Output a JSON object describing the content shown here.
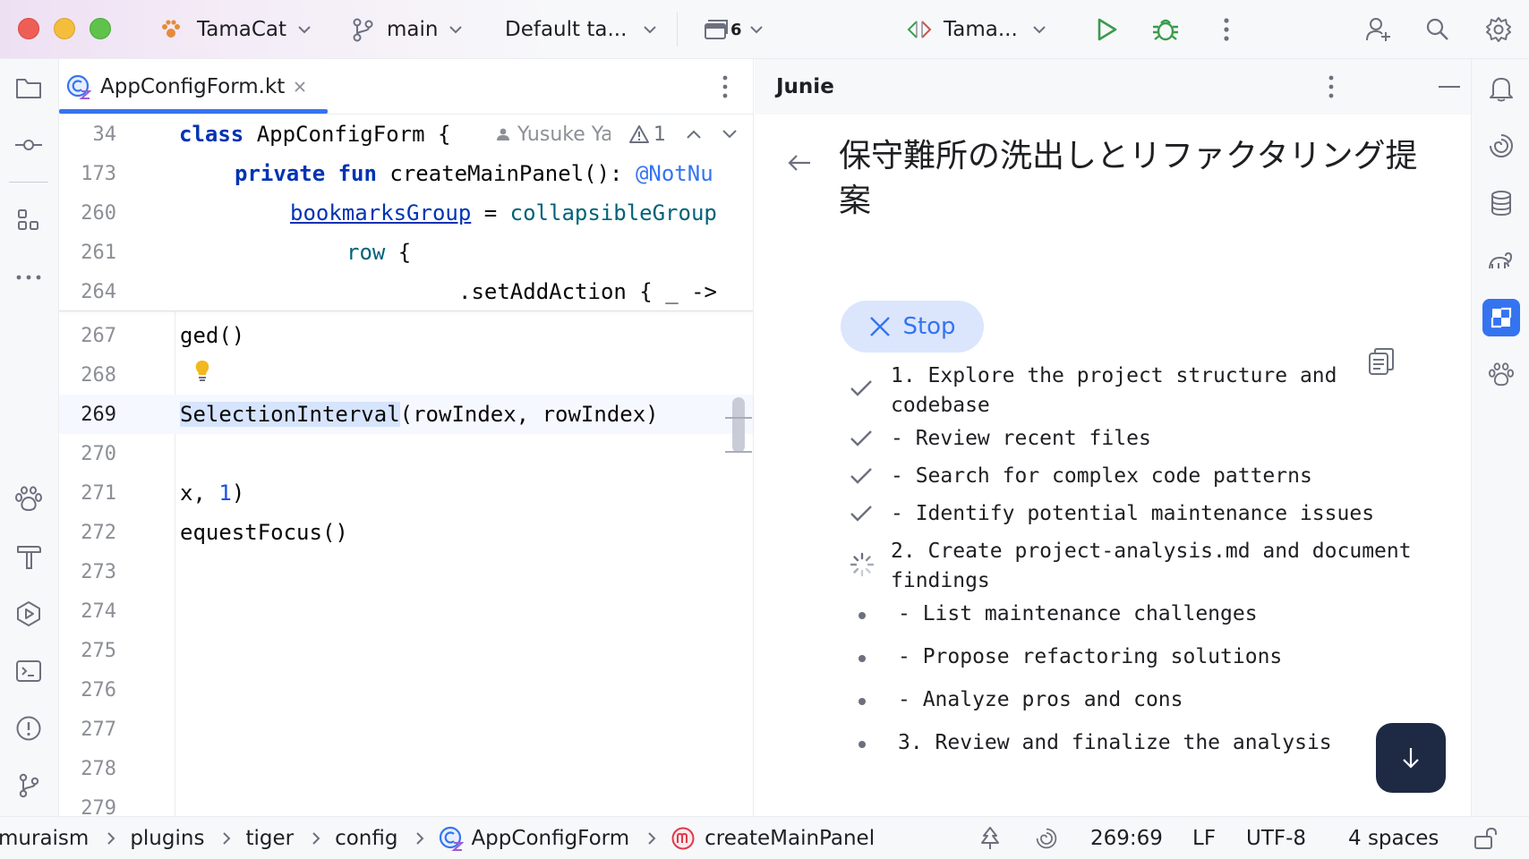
{
  "titlebar": {
    "project_name": "TamaCat",
    "branch_name": "main",
    "task_name": "Default ta...",
    "changes_count": "6",
    "run_config": "Tama...",
    "icons": [
      "project-icon",
      "branch-icon",
      "changes-icon",
      "run-config-icon",
      "run-icon",
      "debug-icon",
      "more-icon",
      "add-user-icon",
      "search-icon",
      "settings-icon"
    ]
  },
  "editor": {
    "tab_label": "AppConfigForm.kt",
    "inline_author": "Yusuke Ya",
    "warning_count": "1",
    "sticky_lines": [
      {
        "num": "34",
        "code": "class AppConfigForm {"
      },
      {
        "num": "173",
        "code": "private fun createMainPanel(): @NotNu"
      },
      {
        "num": "260",
        "code": "bookmarksGroup = collapsibleGroup"
      },
      {
        "num": "261",
        "code": "row {"
      },
      {
        "num": "264",
        "code": ".setAddAction { _ ->"
      }
    ],
    "lines": [
      {
        "num": "267",
        "code": "ged()"
      },
      {
        "num": "268",
        "code": ""
      },
      {
        "num": "269",
        "code": "SelectionInterval(rowIndex, rowIndex)"
      },
      {
        "num": "270",
        "code": ""
      },
      {
        "num": "271",
        "code": "x, 1)"
      },
      {
        "num": "272",
        "code": "equestFocus()"
      },
      {
        "num": "273",
        "code": ""
      },
      {
        "num": "274",
        "code": ""
      },
      {
        "num": "275",
        "code": ""
      },
      {
        "num": "276",
        "code": ""
      },
      {
        "num": "277",
        "code": ""
      },
      {
        "num": "278",
        "code": ""
      },
      {
        "num": "279",
        "code": ""
      }
    ]
  },
  "junie": {
    "panel_title": "Junie",
    "task_title": "保守難所の洗出しとリファクタリング提案",
    "stop_label": "Stop",
    "steps": [
      {
        "status": "done",
        "text": "1. Explore the project structure and codebase"
      },
      {
        "status": "done",
        "text": "- Review recent files"
      },
      {
        "status": "done",
        "text": "- Search for complex code patterns"
      },
      {
        "status": "done",
        "text": "- Identify potential maintenance issues"
      },
      {
        "status": "in-progress",
        "text": "2. Create project-analysis.md and document findings"
      },
      {
        "status": "pending",
        "text": " - List maintenance challenges"
      },
      {
        "status": "pending",
        "text": " - Propose refactoring solutions"
      },
      {
        "status": "pending",
        "text": " - Analyze pros and cons"
      },
      {
        "status": "pending",
        "text": " 3. Review and finalize the analysis"
      }
    ]
  },
  "statusbar": {
    "breadcrumbs": [
      "muraism",
      "plugins",
      "tiger",
      "config",
      "AppConfigForm",
      "createMainPanel"
    ],
    "position": "269:69",
    "line_ending": "LF",
    "encoding": "UTF-8",
    "indent": "4 spaces"
  },
  "colors": {
    "accent": "#3574f0",
    "junie_active": "#3574f0",
    "run_green": "#3a9b4d",
    "close_red": "#ee5e54",
    "minimize_yellow": "#f4bd3c",
    "maximize_green": "#5fc24a"
  }
}
